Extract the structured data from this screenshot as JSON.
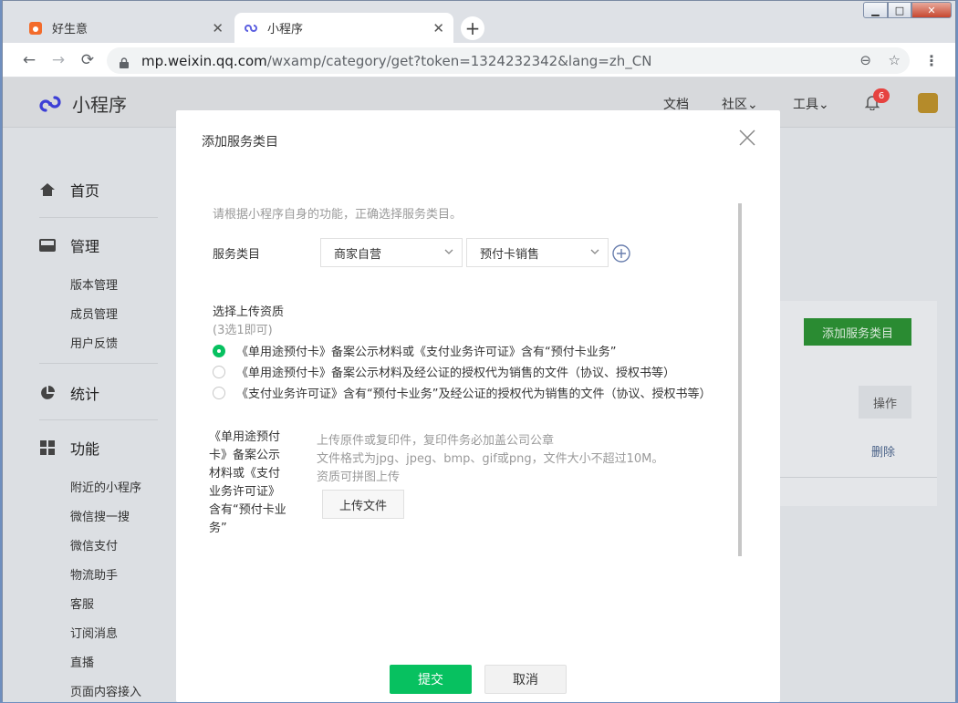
{
  "browser": {
    "tabs": [
      {
        "title": "好生意",
        "close": "✕"
      },
      {
        "title": "小程序",
        "close": "✕"
      }
    ],
    "new_tab": "+",
    "window_controls": {
      "minimize": "▁",
      "maximize": "□",
      "close": "✕"
    },
    "nav": {
      "back": "←",
      "forward": "→",
      "reload": "⟳"
    },
    "url_host": "mp.weixin.qq.com",
    "url_path": "/wxamp/category/get?token=1324232342&lang=zh_CN",
    "zoom_icon": "⊖",
    "star_icon": "☆",
    "menu_icon": "⋮"
  },
  "app": {
    "brand": "小程序",
    "topnav": {
      "docs": "文档",
      "community": "社区⌄",
      "tools": "工具⌄",
      "notification_count": "6"
    },
    "colors": {
      "accent": "#07c160",
      "brand": "#3c3fd6",
      "badge": "#e64340"
    }
  },
  "sidebar": {
    "sections": [
      {
        "label": "首页"
      },
      {
        "label": "管理",
        "items": [
          "版本管理",
          "成员管理",
          "用户反馈"
        ]
      },
      {
        "label": "统计"
      },
      {
        "label": "功能",
        "items": [
          "附近的小程序",
          "微信搜一搜",
          "微信支付",
          "物流助手",
          "客服",
          "订阅消息",
          "直播",
          "页面内容接入"
        ]
      }
    ]
  },
  "background_content": {
    "add_button": "添加服务类目",
    "operation_header": "操作",
    "delete_link": "删除"
  },
  "modal": {
    "title": "添加服务类目",
    "hint": "请根据小程序自身的功能，正确选择服务类目。",
    "category_label": "服务类目",
    "select_primary": "商家自营",
    "select_secondary": "预付卡销售",
    "qualification_label": "选择上传资质",
    "qualification_note": "(3选1即可)",
    "options": [
      {
        "label": "《单用途预付卡》备案公示材料或《支付业务许可证》含有“预付卡业务”",
        "selected": true
      },
      {
        "label": "《单用途预付卡》备案公示材料及经公证的授权代为销售的文件（协议、授权书等）",
        "selected": false
      },
      {
        "label": "《支付业务许可证》含有“预付卡业务”及经公证的授权代为销售的文件（协议、授权书等）",
        "selected": false
      }
    ],
    "doc_name": "《单用途预付卡》备案公示材料或《支付业务许可证》含有“预付卡业务”",
    "upload_notes": [
      "上传原件或复印件，复印件务必加盖公司公章",
      "文件格式为jpg、jpeg、bmp、gif或png，文件大小不超过10M。",
      "资质可拼图上传"
    ],
    "upload_button": "上传文件",
    "submit": "提交",
    "cancel": "取消"
  }
}
